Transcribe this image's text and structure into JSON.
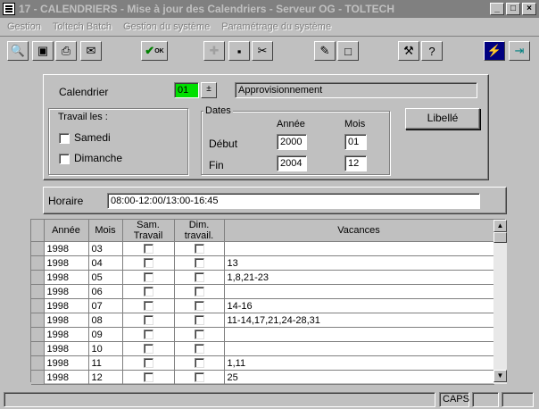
{
  "window": {
    "title": "17 - CALENDRIERS - Mise à jour des Calendriers - Serveur OG - TOLTECH",
    "controls": {
      "minimize": "_",
      "maximize": "□",
      "close": "×"
    }
  },
  "menu": [
    "Gestion",
    "Toltech Batch",
    "Gestion du système",
    "Paramétrage du système"
  ],
  "toolbar": {
    "ok_label": "OK"
  },
  "form": {
    "calendrier_label": "Calendrier",
    "calendrier_code": "01",
    "calendrier_name": "Approvisionnement",
    "spin_glyph": "±",
    "travail_title": "Travail les :",
    "samedi_label": "Samedi",
    "dimanche_label": "Dimanche",
    "dates_title": "Dates",
    "annee_header": "Année",
    "mois_header": "Mois",
    "debut_label": "Début",
    "fin_label": "Fin",
    "debut_annee": "2000",
    "debut_mois": "01",
    "fin_annee": "2004",
    "fin_mois": "12",
    "libelle_button": "Libellé",
    "horaire_label": "Horaire",
    "horaire_value": "08:00-12:00/13:00-16:45"
  },
  "grid": {
    "headers": [
      "Année",
      "Mois",
      "Sam. Travail",
      "Dim. travail.",
      "Vacances"
    ],
    "rows": [
      {
        "annee": "1998",
        "mois": "03",
        "vacances": ""
      },
      {
        "annee": "1998",
        "mois": "04",
        "vacances": "13"
      },
      {
        "annee": "1998",
        "mois": "05",
        "vacances": "1,8,21-23"
      },
      {
        "annee": "1998",
        "mois": "06",
        "vacances": ""
      },
      {
        "annee": "1998",
        "mois": "07",
        "vacances": "14-16"
      },
      {
        "annee": "1998",
        "mois": "08",
        "vacances": "11-14,17,21,24-28,31"
      },
      {
        "annee": "1998",
        "mois": "09",
        "vacances": ""
      },
      {
        "annee": "1998",
        "mois": "10",
        "vacances": ""
      },
      {
        "annee": "1998",
        "mois": "11",
        "vacances": "1,11"
      },
      {
        "annee": "1998",
        "mois": "12",
        "vacances": "25"
      }
    ]
  },
  "status": {
    "caps": "CAPS"
  }
}
